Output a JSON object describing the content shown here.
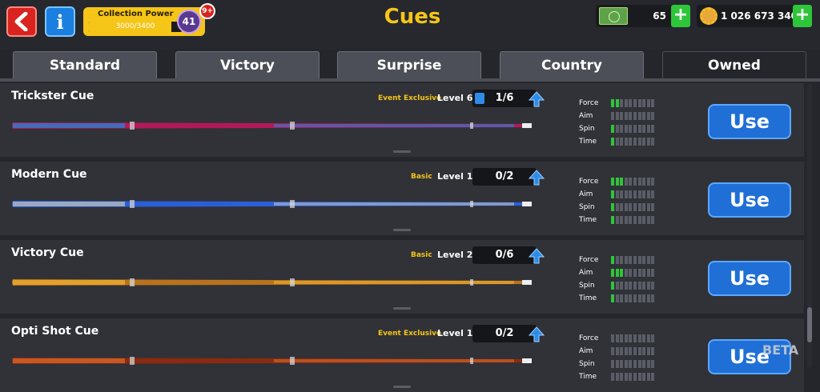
{
  "header": {
    "title": "Cues",
    "collection_label": "Collection Power",
    "collection_progress": "3000/3400",
    "collection_fraction": 0.88,
    "level": "41",
    "notification_badge": "9+",
    "cash": "65",
    "coins": "1 026 673 340"
  },
  "tabs": [
    {
      "label": "Standard",
      "active": false
    },
    {
      "label": "Victory",
      "active": false
    },
    {
      "label": "Surprise",
      "active": false
    },
    {
      "label": "Country",
      "active": false
    },
    {
      "label": "Owned",
      "active": true
    }
  ],
  "stat_labels": [
    "Force",
    "Aim",
    "Spin",
    "Time"
  ],
  "cues": [
    {
      "name": "Trickster Cue",
      "rarity": "Event Exclusive",
      "level": "Level 6",
      "progress": "1/6",
      "stats": [
        2,
        0,
        1,
        1
      ],
      "use_label": "Use",
      "colors": [
        "#b3195a",
        "#1f86d8"
      ]
    },
    {
      "name": "Modern Cue",
      "rarity": "Basic",
      "level": "Level 1",
      "progress": "0/2",
      "stats": [
        3,
        1,
        1,
        1
      ],
      "use_label": "Use",
      "colors": [
        "#2a5fd8",
        "#c0c0c0"
      ]
    },
    {
      "name": "Victory Cue",
      "rarity": "Basic",
      "level": "Level 2",
      "progress": "0/6",
      "stats": [
        1,
        3,
        1,
        1
      ],
      "use_label": "Use",
      "colors": [
        "#b8731c",
        "#f0b030"
      ]
    },
    {
      "name": "Opti Shot Cue",
      "rarity": "Event Exclusive",
      "level": "Level 1",
      "progress": "0/2",
      "stats": [
        0,
        0,
        0,
        0
      ],
      "use_label": "Use",
      "colors": [
        "#8a2a10",
        "#d86a2a"
      ]
    }
  ],
  "beta_label": "BETA",
  "colors": {
    "accent": "#f5c518",
    "use_button": "#1f6fd6",
    "stat_on": "#2fc53a"
  },
  "icons": [
    "back-arrow-icon",
    "info-icon",
    "cash-icon",
    "coin-gear-icon",
    "plus-icon",
    "upgrade-arrow-icon"
  ]
}
